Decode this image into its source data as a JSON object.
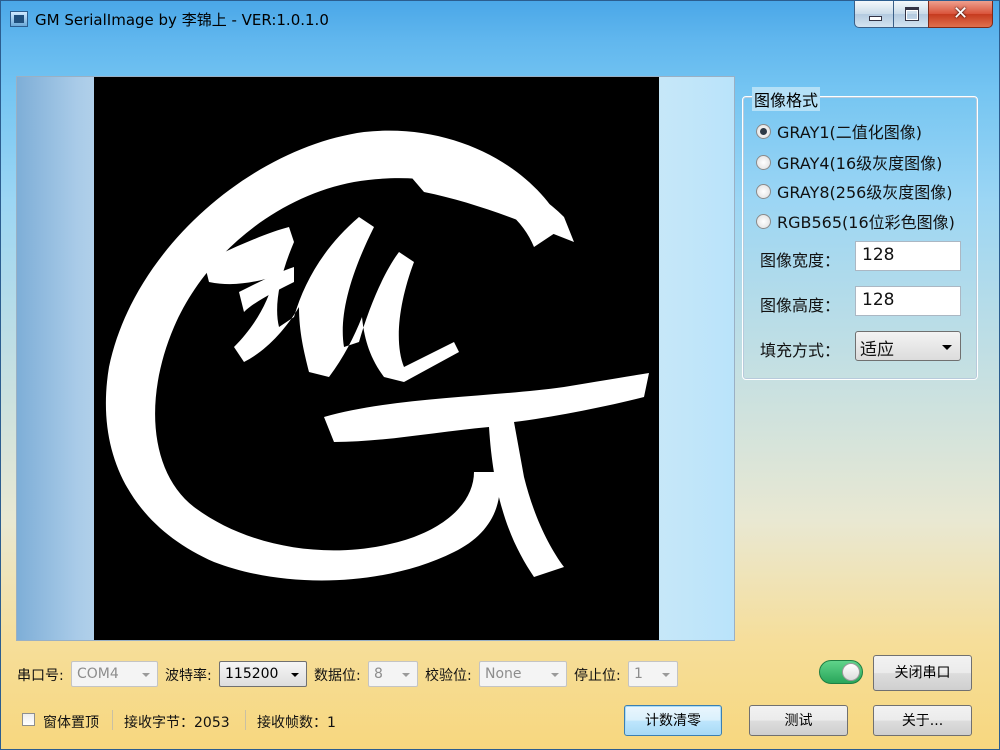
{
  "window": {
    "title": "GM SerialImage by 李锦上 - VER:1.0.1.0"
  },
  "format_group": {
    "title": "图像格式",
    "options": [
      {
        "label": "GRAY1(二值化图像)",
        "selected": true
      },
      {
        "label": "GRAY4(16级灰度图像)",
        "selected": false
      },
      {
        "label": "GRAY8(256级灰度图像)",
        "selected": false
      },
      {
        "label": "RGB565(16位彩色图像)",
        "selected": false
      }
    ],
    "width_label": "图像宽度：",
    "width_value": "128",
    "height_label": "图像高度：",
    "height_value": "128",
    "fill_label": "填充方式：",
    "fill_value": "适应"
  },
  "serial": {
    "port_label": "串口号:",
    "port_value": "COM4",
    "baud_label": "波特率:",
    "baud_value": "115200",
    "data_bits_label": "数据位:",
    "data_bits_value": "8",
    "parity_label": "校验位:",
    "parity_value": "None",
    "stop_bits_label": "停止位:",
    "stop_bits_value": "1",
    "close_port_label": "关闭串口",
    "port_open": true
  },
  "status": {
    "topmost_label": "窗体置顶",
    "topmost_checked": false,
    "bytes_text": "接收字节：2053",
    "frames_text": "接收帧数：1"
  },
  "buttons": {
    "clear_count": "计数清零",
    "test": "测试",
    "about": "关于..."
  },
  "colors": {
    "image_bg": "#000000",
    "image_fg": "#ffffff",
    "toggle_on": "#29a65a"
  }
}
